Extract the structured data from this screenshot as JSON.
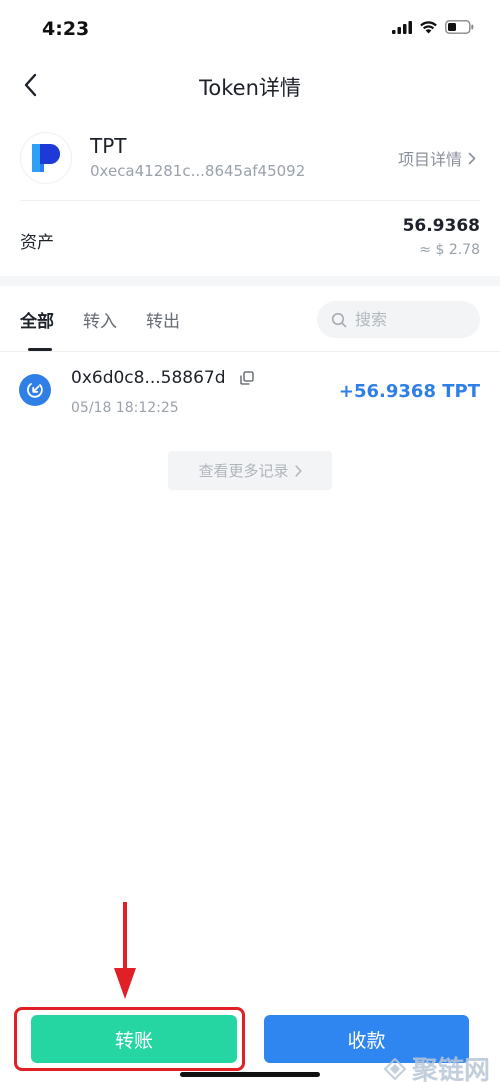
{
  "status_bar": {
    "time": "4:23"
  },
  "nav": {
    "title": "Token详情"
  },
  "token": {
    "name": "TPT",
    "address": "0xeca41281c...8645af45092",
    "project_link": "项目详情"
  },
  "asset": {
    "label": "资产",
    "amount": "56.9368",
    "usd_value": "≈ $ 2.78"
  },
  "tabs": [
    {
      "label": "全部",
      "active": true
    },
    {
      "label": "转入",
      "active": false
    },
    {
      "label": "转出",
      "active": false
    }
  ],
  "search": {
    "placeholder": "搜索"
  },
  "transactions": [
    {
      "address": "0x6d0c8...58867d",
      "time": "05/18 18:12:25",
      "amount": "+56.9368 TPT"
    }
  ],
  "more_records": "查看更多记录",
  "actions": {
    "transfer": "转账",
    "receive": "收款"
  },
  "watermark": "聚链网",
  "colors": {
    "accent_blue": "#2f7fe6",
    "transfer_green": "#26d6a2",
    "receive_blue": "#2f86f1",
    "highlight_red": "#e01f26"
  },
  "icons": {
    "signal": "signal-icon",
    "wifi": "wifi-icon",
    "battery": "battery-icon",
    "back": "chevron-left-icon",
    "token_logo": "tpt-logo",
    "search": "search-icon",
    "copy": "copy-icon",
    "tx_in": "receive-arrow-icon"
  }
}
